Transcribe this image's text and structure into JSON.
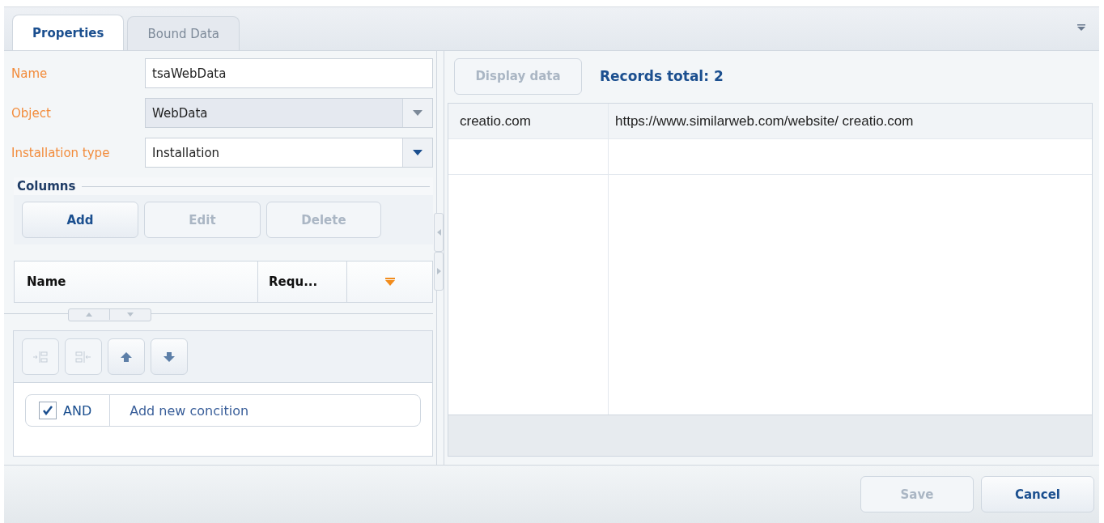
{
  "tabs": [
    {
      "label": "Properties",
      "selected": true
    },
    {
      "label": "Bound Data",
      "selected": false
    }
  ],
  "fields": [
    {
      "label": "Name",
      "kind": "text",
      "value": "tsaWebData",
      "disabled": false
    },
    {
      "label": "Object",
      "kind": "lookup",
      "value": "WebData",
      "disabled": true
    },
    {
      "label": "Installation type",
      "kind": "lookup",
      "value": "Installation",
      "disabled": false
    }
  ],
  "columns_section": {
    "title": "Columns",
    "buttons": [
      {
        "label": "Add",
        "disabled": false
      },
      {
        "label": "Edit",
        "disabled": true
      },
      {
        "label": "Delete",
        "disabled": true
      }
    ],
    "grid_columns": [
      "Name",
      "Requ..."
    ]
  },
  "filter": {
    "tools": [
      {
        "kind": "indent",
        "disabled": true
      },
      {
        "kind": "outdent",
        "disabled": true
      },
      {
        "kind": "up",
        "disabled": false
      },
      {
        "kind": "down",
        "disabled": false
      }
    ],
    "group": {
      "checked": true,
      "operator": "AND",
      "add_link": "Add new concition"
    }
  },
  "data": {
    "display_button": {
      "label": "Display data",
      "disabled": true
    },
    "records_total": "Records total: 2",
    "rows": [
      {
        "selected": true,
        "cells": [
          "creatio.com",
          "https://www.similarweb.com/website/ creatio.com"
        ]
      },
      {
        "selected": false,
        "cells": [
          "",
          ""
        ]
      }
    ]
  },
  "footer": [
    {
      "label": "Save",
      "disabled": true
    },
    {
      "label": "Cancel",
      "disabled": false
    }
  ]
}
